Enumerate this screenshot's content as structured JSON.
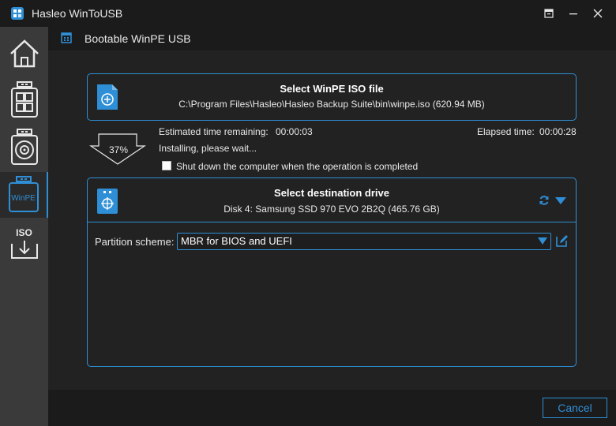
{
  "window": {
    "title": "Hasleo WinToUSB",
    "controls": [
      "restore-icon",
      "minimize-icon",
      "close-icon"
    ]
  },
  "header": {
    "title": "Bootable WinPE USB",
    "icon": "calendar-grid-icon"
  },
  "sidebar": {
    "items": [
      {
        "name": "home",
        "icon": "home-icon",
        "label": ""
      },
      {
        "name": "windows-to-usb",
        "icon": "windows-usb-icon",
        "label": ""
      },
      {
        "name": "disk-image",
        "icon": "disk-usb-icon",
        "label": ""
      },
      {
        "name": "winpe",
        "icon": "winpe-usb-icon",
        "label": "WinPE"
      },
      {
        "name": "iso",
        "icon": "iso-download-icon",
        "label": "ISO"
      }
    ]
  },
  "source": {
    "title": "Select WinPE ISO file",
    "path": "C:\\Program Files\\Hasleo\\Hasleo Backup Suite\\bin\\winpe.iso (620.94 MB)"
  },
  "progress": {
    "percent_label": "37%",
    "estimated_label": "Estimated time remaining:",
    "estimated_value": "00:00:03",
    "elapsed_label": "Elapsed time:",
    "elapsed_value": "00:00:28",
    "status": "Installing, please wait...",
    "shutdown_label": "Shut down the computer when the operation is completed"
  },
  "destination": {
    "title": "Select destination drive",
    "drive": "Disk 4: Samsung SSD 970 EVO 2B2Q (465.76 GB)",
    "partition_label": "Partition scheme:",
    "partition_value": "MBR for BIOS and UEFI"
  },
  "footer": {
    "cancel_label": "Cancel"
  },
  "colors": {
    "accent": "#2f8fd6",
    "background": "#222222",
    "titlebar": "#1b1b1b",
    "sidebar": "#3a3a3a"
  }
}
